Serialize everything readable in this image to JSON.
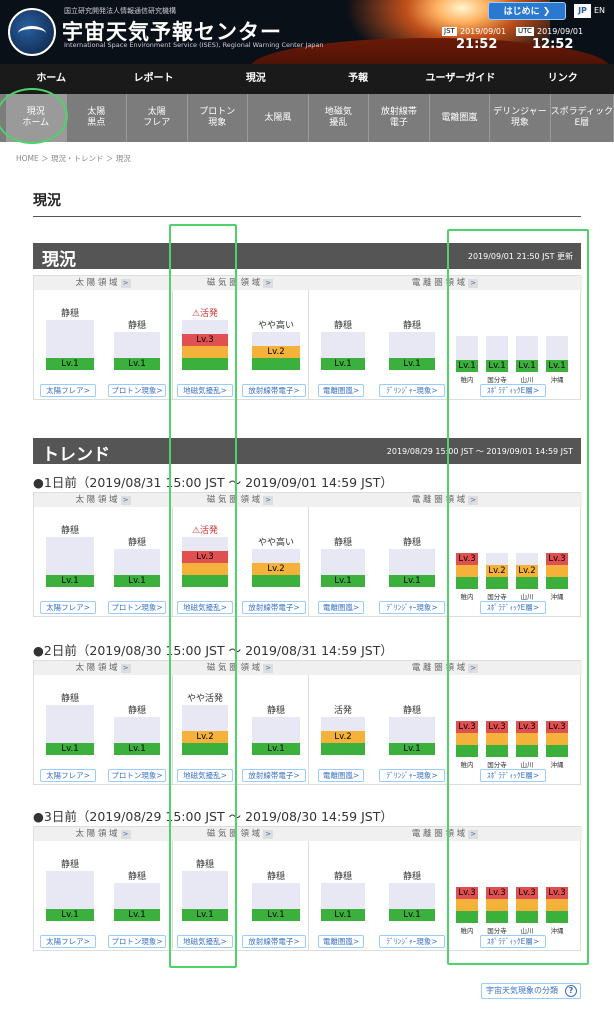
{
  "header": {
    "org": "国立研究開発法人情報通信研究機構",
    "title": "宇宙天気予報センター",
    "subtitle": "International Space Environment Service (ISES), Regional Warning Center Japan",
    "start_button": "はじめに ❯",
    "lang_jp": "JP",
    "lang_en": "EN",
    "jst_label": "JST",
    "jst_date": "2019/09/01",
    "jst_time": "21:52",
    "utc_label": "UTC",
    "utc_date": "2019/09/01",
    "utc_time": "12:52"
  },
  "nav": [
    "ホーム",
    "レポート",
    "現況",
    "予報",
    "ユーザーガイド",
    "リンク"
  ],
  "subnav": [
    "現況\nホーム",
    "太陽\n黒点",
    "太陽\nフレア",
    "プロトン\n現象",
    "太陽風",
    "地磁気\n擾乱",
    "放射線帯\n電子",
    "電離圏嵐",
    "デリンジャー\n現象",
    "スポラディック\nE層"
  ],
  "breadcrumb": "HOME ＞ 現況・トレンド ＞ 現況",
  "page_title": "現況",
  "current": {
    "title": "現況",
    "updated": "2019/09/01 21:50 JST 更新"
  },
  "trend": {
    "title": "トレンド",
    "range": "2019/08/29 15:00 JST 〜 2019/09/01 14:59 JST"
  },
  "trend_rows": [
    "●1日前（2019/08/31 15:00 JST 〜 2019/09/01 14:59 JST）",
    "●2日前（2019/08/30 15:00 JST 〜 2019/08/31 14:59 JST）",
    "●3日前（2019/08/29 15:00 JST 〜 2019/08/30 14:59 JST）"
  ],
  "region_labels": {
    "solar": "太 陽 領 域",
    "magneto": "磁 気 圏 領 域",
    "iono": "電 離 圏 領 域"
  },
  "links": [
    "太陽フレア>",
    "プロトン現象>",
    "地磁気擾乱>",
    "放射線帯電子>",
    "電離圏嵐>",
    "ﾃﾞﾘﾝｼﾞｬｰ現象>",
    "ｽﾎﾟﾗﾃﾞｨｯｸE層>"
  ],
  "prefs": [
    "稚内",
    "国分寺",
    "山川",
    "沖縄"
  ],
  "lv_labels": {
    "1": "Lv.1",
    "2": "Lv.2",
    "3": "Lv.3"
  },
  "status_labels": {
    "quiet": "静穏",
    "slight": "やや高い",
    "slight_active": "やや活発",
    "active": "活発",
    "warn_active": "⚠活発"
  },
  "blocks": [
    {
      "statuses": [
        "静穏",
        "静穏",
        "⚠活発",
        "やや高い",
        "静穏",
        "静穏"
      ],
      "levels": [
        1,
        1,
        3,
        2,
        1,
        1
      ],
      "spor": [
        1,
        1,
        1,
        1
      ]
    },
    {
      "statuses": [
        "静穏",
        "静穏",
        "⚠活発",
        "やや高い",
        "静穏",
        "静穏"
      ],
      "levels": [
        1,
        1,
        3,
        2,
        1,
        1
      ],
      "spor": [
        3,
        2,
        2,
        3
      ]
    },
    {
      "statuses": [
        "静穏",
        "静穏",
        "やや活発",
        "静穏",
        "活発",
        "静穏"
      ],
      "levels": [
        1,
        1,
        2,
        1,
        2,
        1
      ],
      "spor": [
        3,
        3,
        3,
        3
      ]
    },
    {
      "statuses": [
        "静穏",
        "静穏",
        "静穏",
        "静穏",
        "静穏",
        "静穏"
      ],
      "levels": [
        1,
        1,
        1,
        1,
        1,
        1
      ],
      "spor": [
        3,
        3,
        3,
        3
      ]
    }
  ],
  "colors": {
    "lv1": "#3cb03c",
    "lv2": "#f5b23a",
    "lv3": "#e05050",
    "highlight": "#4ed36a"
  },
  "bottom_link": "宇宙天気現象の分類",
  "help_icon_glyph": "?"
}
